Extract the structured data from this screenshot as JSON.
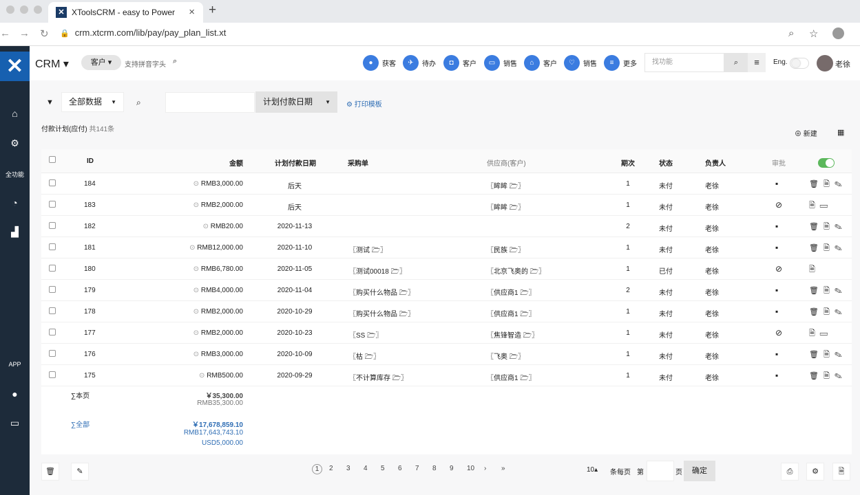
{
  "browser": {
    "tab_title": "XToolsCRM - easy to Power",
    "url": "crm.xtcrm.com/lib/pay/pay_plan_list.xt"
  },
  "header": {
    "brand": "CRM",
    "customer_pill": "客户",
    "search_hint": "支持拼音字头",
    "quick": [
      {
        "label": "获客",
        "icon": "drop-icon"
      },
      {
        "label": "待办",
        "icon": "run-icon"
      },
      {
        "label": "客户",
        "icon": "camera-icon"
      },
      {
        "label": "销售",
        "icon": "card-icon"
      },
      {
        "label": "客户",
        "icon": "bank-icon"
      },
      {
        "label": "销售",
        "icon": "heart-icon"
      },
      {
        "label": "更多",
        "icon": "list-icon"
      }
    ],
    "find_placeholder": "找功能",
    "lang": "Eng.",
    "user": "老徐"
  },
  "sidebar": {
    "items": [
      "全功能",
      "APP"
    ]
  },
  "filter": {
    "scope": "全部数据",
    "date_field": "计划付款日期",
    "print_template": "打印模板"
  },
  "list": {
    "title": "付款计划(应付)",
    "count": "共141条",
    "add": "新建"
  },
  "table": {
    "headers": {
      "id": "ID",
      "amount": "金额",
      "date": "计划付款日期",
      "po": "采购单",
      "supplier": "供应商(客户)",
      "period": "期次",
      "status": "状态",
      "owner": "负责人",
      "audit": "审批"
    },
    "rows": [
      {
        "id": "184",
        "amount": "RMB3,000.00",
        "date": "后天",
        "po": "",
        "supplier": "〖眸眸 🗁〗",
        "period": "1",
        "status": "未付",
        "owner": "老徐",
        "audit": "pending",
        "ops": "🗑 🗎 ✎"
      },
      {
        "id": "183",
        "amount": "RMB2,000.00",
        "date": "后天",
        "po": "",
        "supplier": "〖眸眸 🗁〗",
        "period": "1",
        "status": "未付",
        "owner": "老徐",
        "audit": "approved",
        "ops": "🗎 ▭"
      },
      {
        "id": "182",
        "amount": "RMB20.00",
        "date": "2020-11-13",
        "po": "",
        "supplier": "",
        "period": "2",
        "status": "未付",
        "owner": "老徐",
        "audit": "pending",
        "ops": "🗑 🗎 ✎"
      },
      {
        "id": "181",
        "amount": "RMB12,000.00",
        "date": "2020-11-10",
        "po": "〖测试 🗁〗",
        "supplier": "〖民族 🗁〗",
        "period": "1",
        "status": "未付",
        "owner": "老徐",
        "audit": "pending",
        "ops": "🗑 🗎 ✎"
      },
      {
        "id": "180",
        "amount": "RMB6,780.00",
        "date": "2020-11-05",
        "po": "〖测试00018 🗁〗",
        "supplier": "〖北京飞奥的 🗁〗",
        "period": "1",
        "status": "已付",
        "owner": "老徐",
        "audit": "approved",
        "ops": "🗎"
      },
      {
        "id": "179",
        "amount": "RMB4,000.00",
        "date": "2020-11-04",
        "po": "〖购买什么物品 🗁〗",
        "supplier": "〖供应商1 🗁〗",
        "period": "2",
        "status": "未付",
        "owner": "老徐",
        "audit": "pending",
        "ops": "🗑 🗎 ✎"
      },
      {
        "id": "178",
        "amount": "RMB2,000.00",
        "date": "2020-10-29",
        "po": "〖购买什么物品 🗁〗",
        "supplier": "〖供应商1 🗁〗",
        "period": "1",
        "status": "未付",
        "owner": "老徐",
        "audit": "pending",
        "ops": "🗑 🗎 ✎"
      },
      {
        "id": "177",
        "amount": "RMB2,000.00",
        "date": "2020-10-23",
        "po": "〖SS 🗁〗",
        "supplier": "〖焦锋智造 🗁〗",
        "period": "1",
        "status": "未付",
        "owner": "老徐",
        "audit": "approved",
        "ops": "🗎 ▭"
      },
      {
        "id": "176",
        "amount": "RMB3,000.00",
        "date": "2020-10-09",
        "po": "〖枯 🗁〗",
        "supplier": "〖飞奥 🗁〗",
        "period": "1",
        "status": "未付",
        "owner": "老徐",
        "audit": "pending",
        "ops": "🗑 🗎 ✎"
      },
      {
        "id": "175",
        "amount": "RMB500.00",
        "date": "2020-09-29",
        "po": "〖不计算库存 🗁〗",
        "supplier": "〖供应商1 🗁〗",
        "period": "1",
        "status": "未付",
        "owner": "老徐",
        "audit": "pending",
        "ops": "🗑 🗎 ✎"
      }
    ],
    "sum_page_label": "∑本页",
    "sum_page": [
      "￥35,300.00",
      "RMB35,300.00"
    ],
    "sum_all_label": "∑全部",
    "sum_all": [
      "￥17,678,859.10",
      "RMB17,643,743.10",
      "USD5,000.00"
    ]
  },
  "pager": {
    "pages": [
      "1",
      "2",
      "3",
      "4",
      "5",
      "6",
      "7",
      "8",
      "9",
      "10",
      "›",
      "»"
    ],
    "size": "10",
    "per_page": "条每页",
    "page_prefix": "第",
    "page_suffix": "页",
    "go": "确定"
  },
  "colors": {
    "sidebar": "#1d2b3a",
    "accent": "#3b7ce0",
    "link": "#2e6db4"
  }
}
